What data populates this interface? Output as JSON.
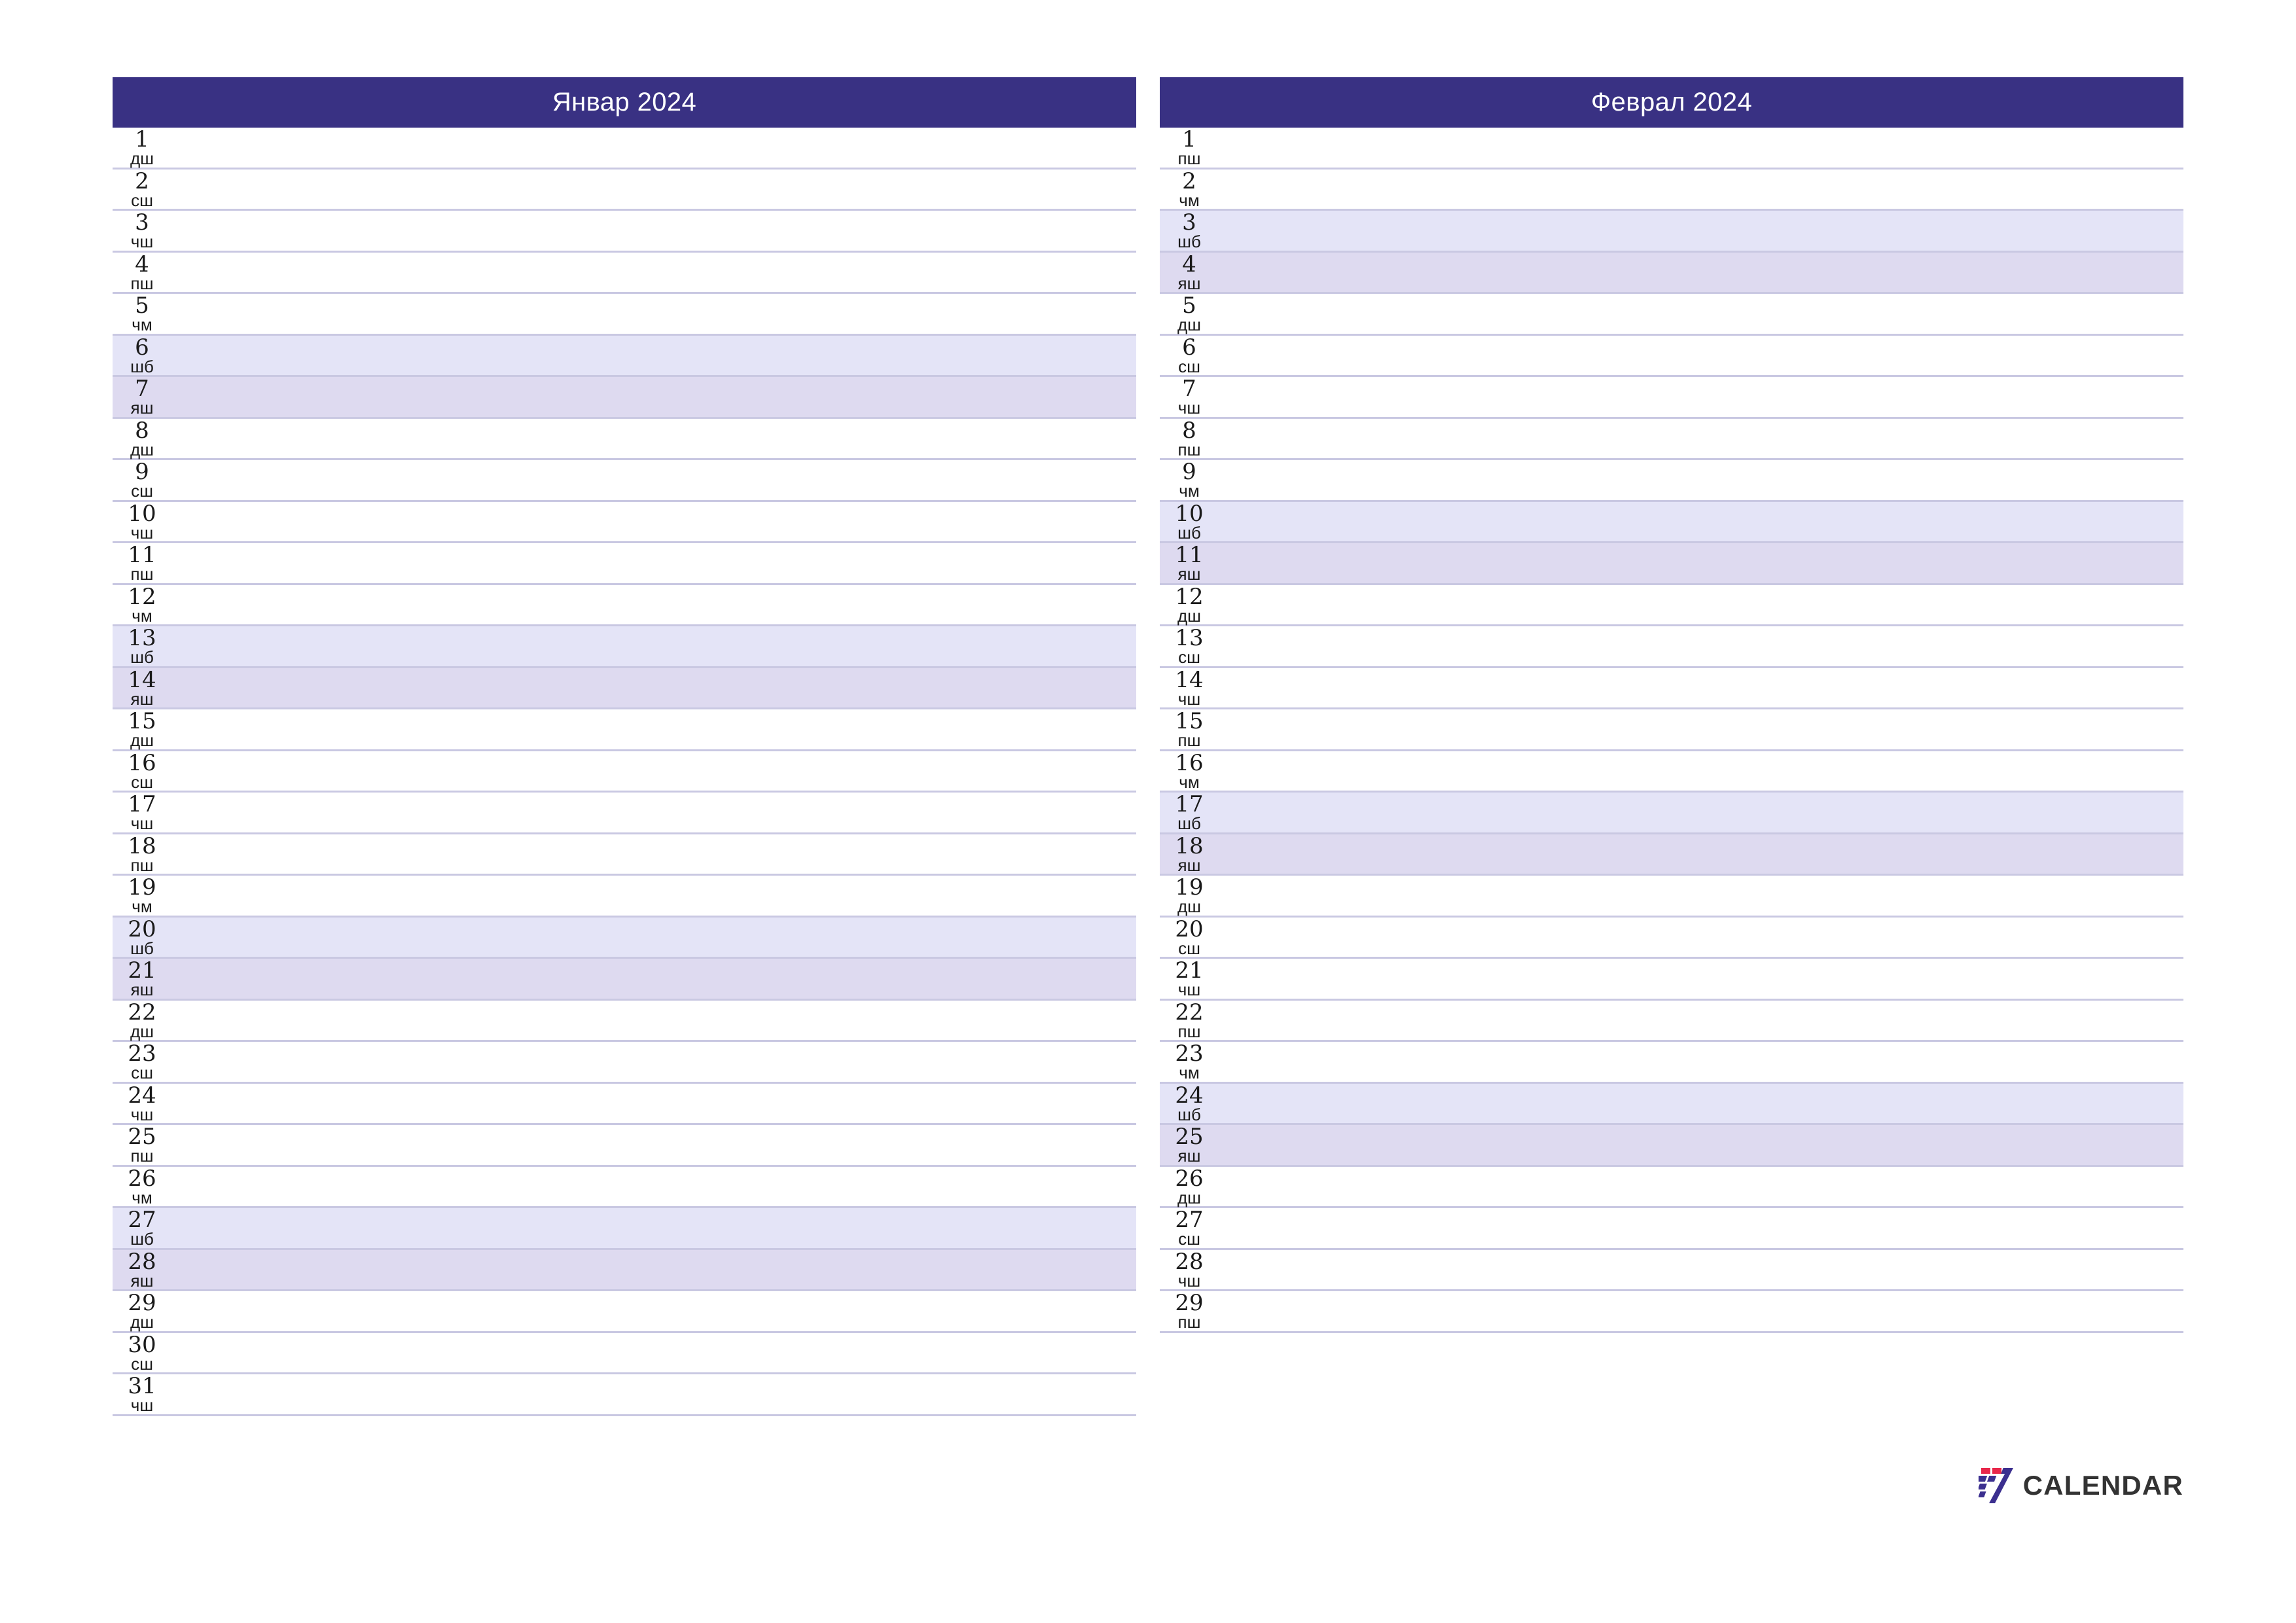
{
  "theme": {
    "header_bg": "#393183",
    "header_text": "#ffffff",
    "saturday_bg": "#e4e4f7",
    "sunday_bg": "#dedaf0",
    "rule_color": "#c9c8e2",
    "page_bg": "#ffffff",
    "logo_red": "#e8264a",
    "logo_blue": "#3b2f8f",
    "logo_text_color": "#333333"
  },
  "logo": {
    "mark_name": "seven-logo-icon",
    "text": "CALENDAR"
  },
  "months": [
    {
      "title": "Январ 2024",
      "days": [
        {
          "num": "1",
          "abbr": "дш",
          "type": "weekday"
        },
        {
          "num": "2",
          "abbr": "сш",
          "type": "weekday"
        },
        {
          "num": "3",
          "abbr": "чш",
          "type": "weekday"
        },
        {
          "num": "4",
          "abbr": "пш",
          "type": "weekday"
        },
        {
          "num": "5",
          "abbr": "чм",
          "type": "weekday"
        },
        {
          "num": "6",
          "abbr": "шб",
          "type": "sat"
        },
        {
          "num": "7",
          "abbr": "яш",
          "type": "sun"
        },
        {
          "num": "8",
          "abbr": "дш",
          "type": "weekday"
        },
        {
          "num": "9",
          "abbr": "сш",
          "type": "weekday"
        },
        {
          "num": "10",
          "abbr": "чш",
          "type": "weekday"
        },
        {
          "num": "11",
          "abbr": "пш",
          "type": "weekday"
        },
        {
          "num": "12",
          "abbr": "чм",
          "type": "weekday"
        },
        {
          "num": "13",
          "abbr": "шб",
          "type": "sat"
        },
        {
          "num": "14",
          "abbr": "яш",
          "type": "sun"
        },
        {
          "num": "15",
          "abbr": "дш",
          "type": "weekday"
        },
        {
          "num": "16",
          "abbr": "сш",
          "type": "weekday"
        },
        {
          "num": "17",
          "abbr": "чш",
          "type": "weekday"
        },
        {
          "num": "18",
          "abbr": "пш",
          "type": "weekday"
        },
        {
          "num": "19",
          "abbr": "чм",
          "type": "weekday"
        },
        {
          "num": "20",
          "abbr": "шб",
          "type": "sat"
        },
        {
          "num": "21",
          "abbr": "яш",
          "type": "sun"
        },
        {
          "num": "22",
          "abbr": "дш",
          "type": "weekday"
        },
        {
          "num": "23",
          "abbr": "сш",
          "type": "weekday"
        },
        {
          "num": "24",
          "abbr": "чш",
          "type": "weekday"
        },
        {
          "num": "25",
          "abbr": "пш",
          "type": "weekday"
        },
        {
          "num": "26",
          "abbr": "чм",
          "type": "weekday"
        },
        {
          "num": "27",
          "abbr": "шб",
          "type": "sat"
        },
        {
          "num": "28",
          "abbr": "яш",
          "type": "sun"
        },
        {
          "num": "29",
          "abbr": "дш",
          "type": "weekday"
        },
        {
          "num": "30",
          "abbr": "сш",
          "type": "weekday"
        },
        {
          "num": "31",
          "abbr": "чш",
          "type": "weekday"
        }
      ]
    },
    {
      "title": "Феврал 2024",
      "days": [
        {
          "num": "1",
          "abbr": "пш",
          "type": "weekday"
        },
        {
          "num": "2",
          "abbr": "чм",
          "type": "weekday"
        },
        {
          "num": "3",
          "abbr": "шб",
          "type": "sat"
        },
        {
          "num": "4",
          "abbr": "яш",
          "type": "sun"
        },
        {
          "num": "5",
          "abbr": "дш",
          "type": "weekday"
        },
        {
          "num": "6",
          "abbr": "сш",
          "type": "weekday"
        },
        {
          "num": "7",
          "abbr": "чш",
          "type": "weekday"
        },
        {
          "num": "8",
          "abbr": "пш",
          "type": "weekday"
        },
        {
          "num": "9",
          "abbr": "чм",
          "type": "weekday"
        },
        {
          "num": "10",
          "abbr": "шб",
          "type": "sat"
        },
        {
          "num": "11",
          "abbr": "яш",
          "type": "sun"
        },
        {
          "num": "12",
          "abbr": "дш",
          "type": "weekday"
        },
        {
          "num": "13",
          "abbr": "сш",
          "type": "weekday"
        },
        {
          "num": "14",
          "abbr": "чш",
          "type": "weekday"
        },
        {
          "num": "15",
          "abbr": "пш",
          "type": "weekday"
        },
        {
          "num": "16",
          "abbr": "чм",
          "type": "weekday"
        },
        {
          "num": "17",
          "abbr": "шб",
          "type": "sat"
        },
        {
          "num": "18",
          "abbr": "яш",
          "type": "sun"
        },
        {
          "num": "19",
          "abbr": "дш",
          "type": "weekday"
        },
        {
          "num": "20",
          "abbr": "сш",
          "type": "weekday"
        },
        {
          "num": "21",
          "abbr": "чш",
          "type": "weekday"
        },
        {
          "num": "22",
          "abbr": "пш",
          "type": "weekday"
        },
        {
          "num": "23",
          "abbr": "чм",
          "type": "weekday"
        },
        {
          "num": "24",
          "abbr": "шб",
          "type": "sat"
        },
        {
          "num": "25",
          "abbr": "яш",
          "type": "sun"
        },
        {
          "num": "26",
          "abbr": "дш",
          "type": "weekday"
        },
        {
          "num": "27",
          "abbr": "сш",
          "type": "weekday"
        },
        {
          "num": "28",
          "abbr": "чш",
          "type": "weekday"
        },
        {
          "num": "29",
          "abbr": "пш",
          "type": "weekday"
        }
      ]
    }
  ]
}
